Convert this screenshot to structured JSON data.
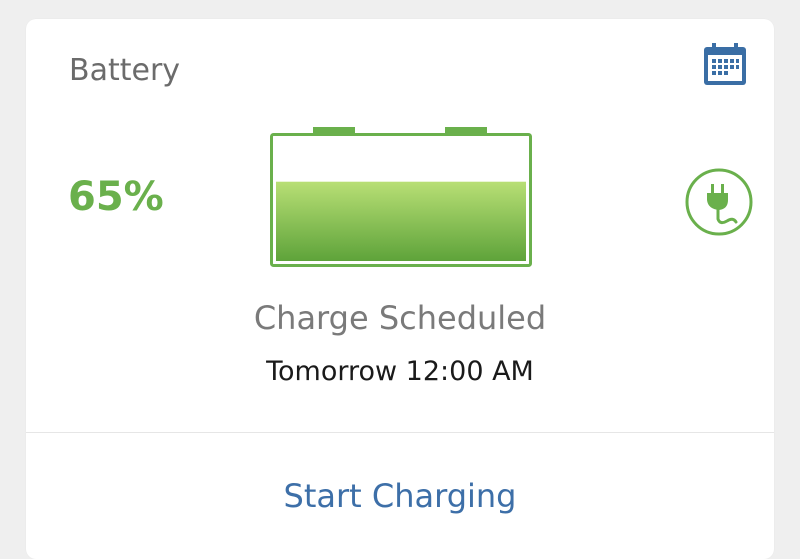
{
  "card": {
    "title": "Battery",
    "calendar_icon": "calendar-icon",
    "plug_icon": "plug-icon"
  },
  "battery": {
    "percent_label": "65%",
    "level": 0.65,
    "status": "Charge Scheduled",
    "scheduled_time": "Tomorrow 12:00 AM"
  },
  "action": {
    "label": "Start Charging"
  },
  "colors": {
    "accent_green": "#6ab04c",
    "action_blue": "#3d6fa8",
    "calendar_blue": "#3a6ea5"
  }
}
